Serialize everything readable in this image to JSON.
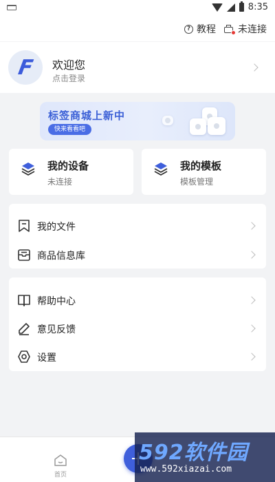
{
  "status_bar": {
    "time": "8:35"
  },
  "top_bar": {
    "tutorial_label": "教程",
    "connection_label": "未连接"
  },
  "profile": {
    "welcome": "欢迎您",
    "login_hint": "点击登录",
    "avatar_letter": "F"
  },
  "banner": {
    "title": "标签商城上新中",
    "button_label": "快来看看吧"
  },
  "cards": [
    {
      "title": "我的设备",
      "subtitle": "未连接"
    },
    {
      "title": "我的模板",
      "subtitle": "模板管理"
    }
  ],
  "menu_group_1": [
    {
      "label": "我的文件",
      "icon": "bookmark-icon"
    },
    {
      "label": "商品信息库",
      "icon": "inbox-icon"
    }
  ],
  "menu_group_2": [
    {
      "label": "帮助中心",
      "icon": "book-icon"
    },
    {
      "label": "意见反馈",
      "icon": "pen-icon"
    },
    {
      "label": "设置",
      "icon": "hexagon-settings-icon"
    }
  ],
  "bottom_nav": {
    "home_label": "首页"
  },
  "watermark": {
    "logo_text": "592软件园",
    "url": "www.592xiazai.com"
  },
  "colors": {
    "accent": "#3f5fdb",
    "background": "#f2f3f5",
    "banner_text": "#3a5fd6",
    "badge_red": "#e53935"
  }
}
